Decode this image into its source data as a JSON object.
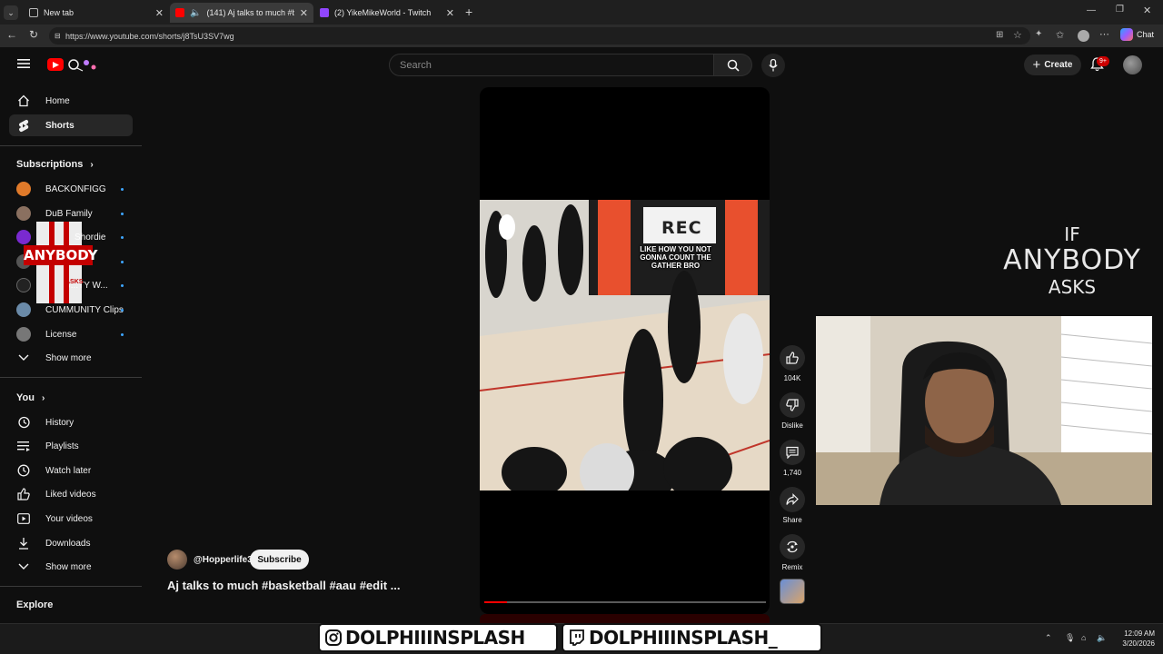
{
  "browser": {
    "tabs": [
      {
        "title": "New tab"
      },
      {
        "title": "(141) Aj talks to much #baske"
      },
      {
        "title": "(2) YikeMikeWorld - Twitch"
      }
    ],
    "url": "https://www.youtube.com/shorts/j8TsU3SV7wg",
    "chat_label": "Chat"
  },
  "header": {
    "search_placeholder": "Search",
    "create_label": "Create",
    "notifications_badge": "9+"
  },
  "sidebar": {
    "main": [
      {
        "label": "Home"
      },
      {
        "label": "Shorts"
      }
    ],
    "subscriptions_title": "Subscriptions",
    "subscriptions": [
      {
        "label": "BACKONFIGG"
      },
      {
        "label": "DuB Family"
      },
      {
        "label": "Shordie"
      },
      {
        "label": ""
      },
      {
        "label": "G...TY W..."
      },
      {
        "label": "CUMMUNITY Clips"
      },
      {
        "label": "License"
      }
    ],
    "show_more": "Show more",
    "you_title": "You",
    "you_items": [
      {
        "label": "History"
      },
      {
        "label": "Playlists"
      },
      {
        "label": "Watch later"
      },
      {
        "label": "Liked videos"
      },
      {
        "label": "Your videos"
      },
      {
        "label": "Downloads"
      }
    ],
    "show_more_2": "Show more",
    "explore_title": "Explore"
  },
  "short": {
    "overlay_caption": "LIKE HOW YOU NOT GONNA COUNT THE GATHER BRO",
    "sign_text": "REC",
    "channel": "@Hopperlife3",
    "subscribe_label": "Subscribe",
    "title": "Aj talks to much #basketball #aau #edit ...",
    "progress": 0.08,
    "actions": [
      {
        "name": "like",
        "label": "104K"
      },
      {
        "name": "dislike",
        "label": "Dislike"
      },
      {
        "name": "comments",
        "label": "1,740"
      },
      {
        "name": "share",
        "label": "Share"
      },
      {
        "name": "remix",
        "label": "Remix"
      }
    ]
  },
  "overlay": {
    "line1": "IF",
    "line2": "ANYBODY",
    "line3": "ASKS",
    "small_logo_text": "ANYBODY",
    "small_logo_sub": "ASKS"
  },
  "stream": {
    "instagram_handle": "DOLPHIIINSPLASH",
    "twitch_handle": "DOLPHIIINSPLASH_"
  },
  "taskbar": {
    "time": "12:09 AM",
    "date": "3/20/2026"
  },
  "colors": {
    "accent_red": "#ff0000",
    "link_blue": "#3ea6ff",
    "twitch_purple": "#9146ff"
  }
}
